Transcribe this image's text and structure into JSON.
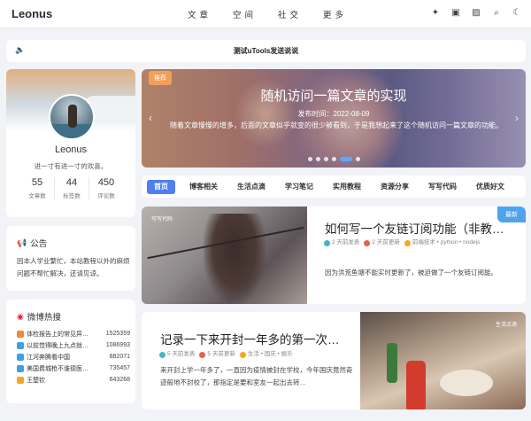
{
  "header": {
    "logo": "Leonus",
    "nav": [
      "文章",
      "空间",
      "社交",
      "更多"
    ],
    "tools": [
      {
        "icon": "spark-icon",
        "glyph": "✦"
      },
      {
        "icon": "subway-icon",
        "glyph": "▣"
      },
      {
        "icon": "image-icon",
        "glyph": "▨"
      },
      {
        "icon": "search-icon",
        "glyph": "⌕"
      },
      {
        "icon": "moon-icon",
        "glyph": "☾"
      }
    ]
  },
  "notice": {
    "icon": "speaker-icon",
    "glyph": "🔈",
    "text": "测试uTools发送说说"
  },
  "profile": {
    "name": "Leonus",
    "motto": "进一寸有进一寸的欢喜。",
    "stats": [
      {
        "num": "55",
        "label": "文章数"
      },
      {
        "num": "44",
        "label": "标签数"
      },
      {
        "num": "450",
        "label": "评论数"
      }
    ]
  },
  "announcement": {
    "title": "公告",
    "body": "因本人学业繁忙，本站教程以外的麻烦问题不帮忙解决，还请见谅。"
  },
  "weibo": {
    "title": "微博热搜",
    "items": [
      {
        "title": "体检报告上的常见异…",
        "value": "1525359",
        "color": "#f28a2e"
      },
      {
        "title": "以前觉得晚上九点就…",
        "value": "1086993",
        "color": "#f5a623"
      },
      {
        "title": "江河奔腾看中国",
        "value": "882071",
        "color": "#3fa0e0"
      },
      {
        "title": "美国费城枪不谁德医…",
        "value": "735457",
        "color": "#3fa0e0"
      },
      {
        "title": "王楚钦",
        "value": "643268",
        "color": "#f5a623"
      }
    ]
  },
  "carousel": {
    "tag": "推荐",
    "title": "随机访问一篇文章的实现",
    "date": "发布时间：2022-08-09",
    "desc": "随着文章慢慢的增多，后面的文章似乎就变的很少被看到，于是我想起来了这个随机访问一篇文章的功能。",
    "prev": "‹",
    "next": "›",
    "dots": 6,
    "active_dot": 4
  },
  "tabs": [
    "首页",
    "博客相关",
    "生活点滴",
    "学习笔记",
    "实用教程",
    "资源分享",
    "写写代码",
    "优质好文"
  ],
  "posts": [
    {
      "category": "写写代码",
      "badge": "最新",
      "title": "如何写一个友链订阅功能（非教…",
      "published": "2 天前发表",
      "updated": "2 天前更新",
      "tags": "前端技术 • python • nodejs",
      "excerpt": "因为洪荒鱼塘不能实时更新了，被迫做了一个友链订阅能。"
    },
    {
      "category": "生活点滴",
      "title": "记录一下来开封一年多的第一次…",
      "published": "5 天前发表",
      "updated": "5 天前更新",
      "tags": "生活 • 国庆 • 娱乐",
      "excerpt": "来开封上学一年多了，一直因为疫情被封在学校，今年国庆竟然奇迹般地不封校了，那指定是要和室友一起出去转…"
    }
  ]
}
